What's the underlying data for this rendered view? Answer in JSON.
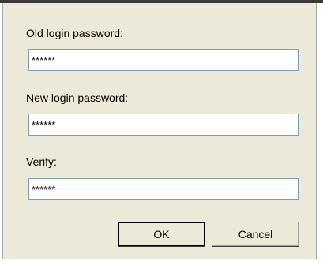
{
  "dialog": {
    "old_password": {
      "label": "Old login password:",
      "value": "******"
    },
    "new_password": {
      "label": "New login password:",
      "value": "******"
    },
    "verify": {
      "label": "Verify:",
      "value": "******"
    },
    "buttons": {
      "ok_label": "OK",
      "cancel_label": "Cancel"
    }
  }
}
